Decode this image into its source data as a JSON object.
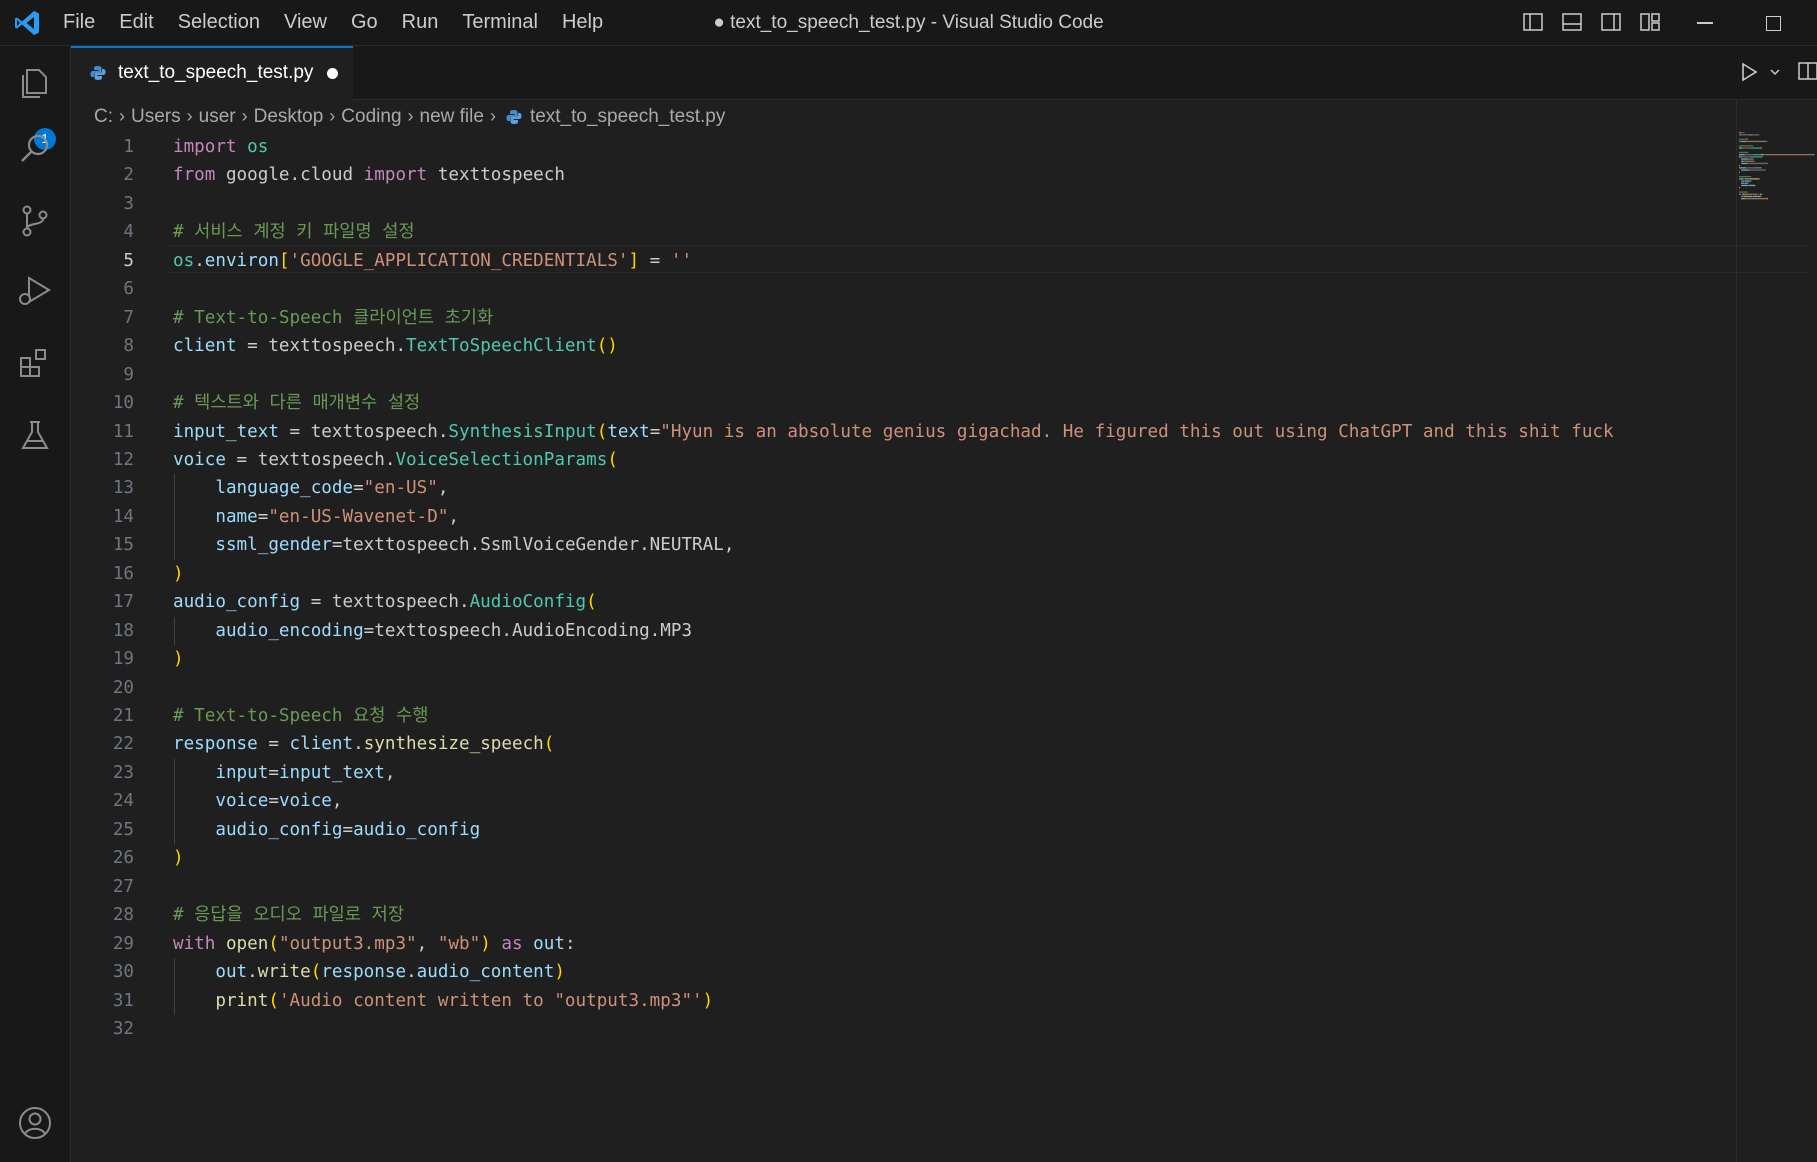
{
  "window": {
    "title": "● text_to_speech_test.py - Visual Studio Code",
    "menu": [
      "File",
      "Edit",
      "Selection",
      "View",
      "Go",
      "Run",
      "Terminal",
      "Help"
    ]
  },
  "activity_bar": {
    "items": [
      "explorer-icon",
      "search-icon",
      "source-control-icon",
      "run-debug-icon",
      "extensions-icon",
      "testing-icon"
    ],
    "explorer_badge": "1",
    "bottom": [
      "accounts-icon"
    ]
  },
  "tab": {
    "label": "text_to_speech_test.py",
    "dirty": true
  },
  "breadcrumb": [
    "C:",
    "Users",
    "user",
    "Desktop",
    "Coding",
    "new file",
    "text_to_speech_test.py"
  ],
  "editor": {
    "active_line": 5,
    "lines": [
      [
        [
          "kw",
          "import"
        ],
        [
          "p",
          " "
        ],
        [
          "mod",
          "os"
        ]
      ],
      [
        [
          "kw",
          "from"
        ],
        [
          "p",
          " google.cloud "
        ],
        [
          "kw",
          "import"
        ],
        [
          "p",
          " texttospeech"
        ]
      ],
      [],
      [
        [
          "com",
          "# 서비스 계정 키 파일명 설정"
        ]
      ],
      [
        [
          "mod",
          "os"
        ],
        [
          "p",
          "."
        ],
        [
          "var",
          "environ"
        ],
        [
          "par1",
          "["
        ],
        [
          "str",
          "'GOOGLE_APPLICATION_CREDENTIALS'"
        ],
        [
          "par1",
          "]"
        ],
        [
          "p",
          " = "
        ],
        [
          "str",
          "''"
        ]
      ],
      [],
      [
        [
          "com",
          "# Text-to-Speech 클라이언트 초기화"
        ]
      ],
      [
        [
          "var",
          "client"
        ],
        [
          "p",
          " = texttospeech."
        ],
        [
          "mod",
          "TextToSpeechClient"
        ],
        [
          "par1",
          "()"
        ]
      ],
      [],
      [
        [
          "com",
          "# 텍스트와 다른 매개변수 설정"
        ]
      ],
      [
        [
          "var",
          "input_text"
        ],
        [
          "p",
          " = texttospeech."
        ],
        [
          "mod",
          "SynthesisInput"
        ],
        [
          "par1",
          "("
        ],
        [
          "var",
          "text"
        ],
        [
          "p",
          "="
        ],
        [
          "str",
          "\"Hyun is an absolute genius gigachad. He figured this out using ChatGPT and this shit fuck"
        ]
      ],
      [
        [
          "var",
          "voice"
        ],
        [
          "p",
          " = texttospeech."
        ],
        [
          "mod",
          "VoiceSelectionParams"
        ],
        [
          "par1",
          "("
        ]
      ],
      [
        [
          "p",
          "    "
        ],
        [
          "var",
          "language_code"
        ],
        [
          "p",
          "="
        ],
        [
          "str",
          "\"en-US\""
        ],
        [
          "p",
          ","
        ]
      ],
      [
        [
          "p",
          "    "
        ],
        [
          "var",
          "name"
        ],
        [
          "p",
          "="
        ],
        [
          "str",
          "\"en-US-Wavenet-D\""
        ],
        [
          "p",
          ","
        ]
      ],
      [
        [
          "p",
          "    "
        ],
        [
          "var",
          "ssml_gender"
        ],
        [
          "p",
          "=texttospeech.SsmlVoiceGender.NEUTRAL,"
        ]
      ],
      [
        [
          "par1",
          ")"
        ]
      ],
      [
        [
          "var",
          "audio_config"
        ],
        [
          "p",
          " = texttospeech."
        ],
        [
          "mod",
          "AudioConfig"
        ],
        [
          "par1",
          "("
        ]
      ],
      [
        [
          "p",
          "    "
        ],
        [
          "var",
          "audio_encoding"
        ],
        [
          "p",
          "=texttospeech.AudioEncoding.MP3"
        ]
      ],
      [
        [
          "par1",
          ")"
        ]
      ],
      [],
      [
        [
          "com",
          "# Text-to-Speech 요청 수행"
        ]
      ],
      [
        [
          "var",
          "response"
        ],
        [
          "p",
          " = "
        ],
        [
          "var",
          "client"
        ],
        [
          "p",
          "."
        ],
        [
          "fn",
          "synthesize_speech"
        ],
        [
          "par1",
          "("
        ]
      ],
      [
        [
          "p",
          "    "
        ],
        [
          "var",
          "input"
        ],
        [
          "p",
          "="
        ],
        [
          "var",
          "input_text"
        ],
        [
          "p",
          ","
        ]
      ],
      [
        [
          "p",
          "    "
        ],
        [
          "var",
          "voice"
        ],
        [
          "p",
          "="
        ],
        [
          "var",
          "voice"
        ],
        [
          "p",
          ","
        ]
      ],
      [
        [
          "p",
          "    "
        ],
        [
          "var",
          "audio_config"
        ],
        [
          "p",
          "="
        ],
        [
          "var",
          "audio_config"
        ]
      ],
      [
        [
          "par1",
          ")"
        ]
      ],
      [],
      [
        [
          "com",
          "# 응답을 오디오 파일로 저장"
        ]
      ],
      [
        [
          "kw",
          "with"
        ],
        [
          "p",
          " "
        ],
        [
          "fn",
          "open"
        ],
        [
          "par1",
          "("
        ],
        [
          "str",
          "\"output3.mp3\""
        ],
        [
          "p",
          ", "
        ],
        [
          "str",
          "\"wb\""
        ],
        [
          "par1",
          ")"
        ],
        [
          "p",
          " "
        ],
        [
          "kw",
          "as"
        ],
        [
          "p",
          " "
        ],
        [
          "var",
          "out"
        ],
        [
          "p",
          ":"
        ]
      ],
      [
        [
          "p",
          "    "
        ],
        [
          "var",
          "out"
        ],
        [
          "p",
          "."
        ],
        [
          "fn",
          "write"
        ],
        [
          "par1",
          "("
        ],
        [
          "var",
          "response"
        ],
        [
          "p",
          "."
        ],
        [
          "var",
          "audio_content"
        ],
        [
          "par1",
          ")"
        ]
      ],
      [
        [
          "p",
          "    "
        ],
        [
          "fn",
          "print"
        ],
        [
          "par1",
          "("
        ],
        [
          "str",
          "'Audio content written to \"output3.mp3\"'"
        ],
        [
          "par1",
          ")"
        ]
      ],
      []
    ]
  },
  "colors": {
    "accent": "#0078d4",
    "keyword": "#c586c0",
    "type": "#4ec9b0",
    "variable": "#9cdcfe",
    "function": "#dcdcaa",
    "string": "#ce9178",
    "comment": "#6a9955",
    "bracket": "#ffd700"
  }
}
